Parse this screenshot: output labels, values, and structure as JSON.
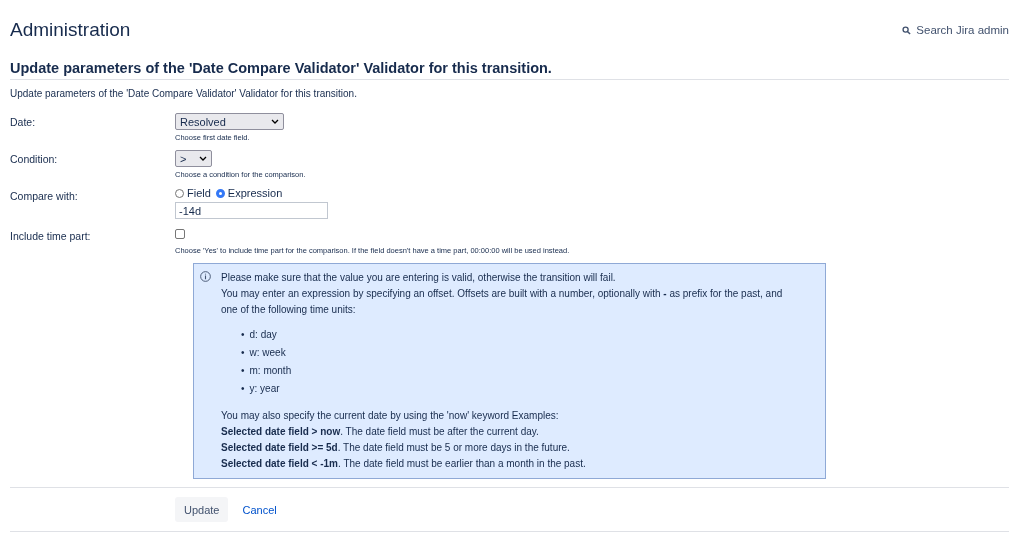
{
  "header": {
    "title": "Administration",
    "search": "Search Jira admin"
  },
  "form": {
    "title": "Update parameters of the 'Date Compare Validator' Validator for this transition.",
    "description": "Update parameters of the 'Date Compare Validator' Validator for this transition.",
    "fields": [
      {
        "kind": "select",
        "label": "Date:",
        "value": "Resolved",
        "hint": "Choose first date field."
      },
      {
        "kind": "select",
        "label": "Condition:",
        "value": ">",
        "hint": "Choose a condition for the comparison."
      },
      {
        "kind": "radio",
        "label": "Compare with:",
        "options": [
          {
            "label": "Field",
            "selected": false
          },
          {
            "label": "Expression",
            "selected": true
          }
        ],
        "value": "-14d"
      },
      {
        "kind": "checkbox",
        "label": "Include time part:",
        "checked": false,
        "hint": "Choose 'Yes' to include time part for the comparison. If the field doesn't have a time part, 00:00:00 will be used instead."
      }
    ]
  },
  "info": {
    "paragraphs": [
      "Please make sure that the value you are entering is valid, otherwise the transition will fail.",
      "You may enter an expression by specifying an offset. Offsets are built with a number, optionally with **-** as prefix for the past, and one of the following time units:"
    ],
    "bullet": "•",
    "units": [
      "d: day",
      "w: week",
      "m: month",
      "y: year"
    ],
    "examples_intro": "You may also specify the current date by using the 'now' keyword Examples:",
    "examples": [
      "**Selected date field > now**. The date field must be after the current day.",
      "**Selected date field >= 5d**. The date field must be 5 or more days in the future.",
      "**Selected date field < -1m**. The date field must be earlier than a month in the past."
    ]
  },
  "buttons": {
    "update": "Update",
    "cancel": "Cancel"
  }
}
